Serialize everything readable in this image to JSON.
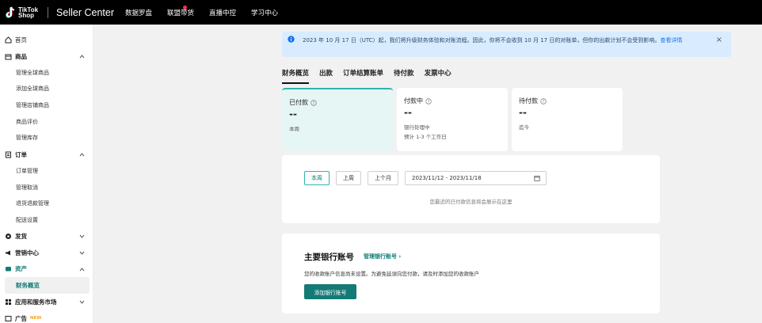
{
  "topbar": {
    "logo_line1": "TikTok",
    "logo_line2": "Shop",
    "brand": "Seller Center",
    "nav": [
      "数据罗盘",
      "联盟带货",
      "直播中控",
      "学习中心"
    ]
  },
  "sidebar": {
    "home": "首页",
    "products": {
      "label": "商品",
      "items": [
        "管理全球商品",
        "添加全球商品",
        "管理店铺商品",
        "商品评价",
        "管理库存"
      ]
    },
    "orders": {
      "label": "订单",
      "items": [
        "订单管理",
        "管理取消",
        "退货退款管理",
        "配送设置"
      ]
    },
    "shipping": "发货",
    "marketing": "营销中心",
    "assets": {
      "label": "资产",
      "items": [
        "财务概览"
      ]
    },
    "apps": "应用和服务市场",
    "ads": "广告",
    "ads_badge": "NEW"
  },
  "banner": {
    "text": "2023 年 10 月 17 日（UTC）起，我们将升级财务体验和对账流程。因此，你将不会收到 10 月 17 日的对账单，但你的出款计划不会受到影响。",
    "link": "查看详情",
    "close": "×"
  },
  "tabs": [
    "财务概览",
    "出款",
    "订单结算账单",
    "待付款",
    "发票中心"
  ],
  "cards": [
    {
      "title": "已付款",
      "value": "--",
      "sub": "本周",
      "sub2": ""
    },
    {
      "title": "付款中",
      "value": "--",
      "sub": "银行处理中",
      "sub2": "预计 1-3 个工作日"
    },
    {
      "title": "待付款",
      "value": "--",
      "sub": "迄今",
      "sub2": ""
    }
  ],
  "filters": {
    "periods": [
      "本周",
      "上周",
      "上个月"
    ],
    "date_range": "2023/11/12 - 2023/11/18",
    "empty": "您最近的已付款信息将会展示在这里"
  },
  "bank": {
    "title": "主要银行账号",
    "manage_link": "管理银行账号 ›",
    "desc": "您的收款账户信息尚未设置。为避免延误向您付款，请及时添加您的收款账户",
    "add_button": "添加银行账号"
  },
  "colors": {
    "accent": "#137a75",
    "banner_bg": "#d9ecff",
    "active_card_bg": "#e6f6f5"
  }
}
